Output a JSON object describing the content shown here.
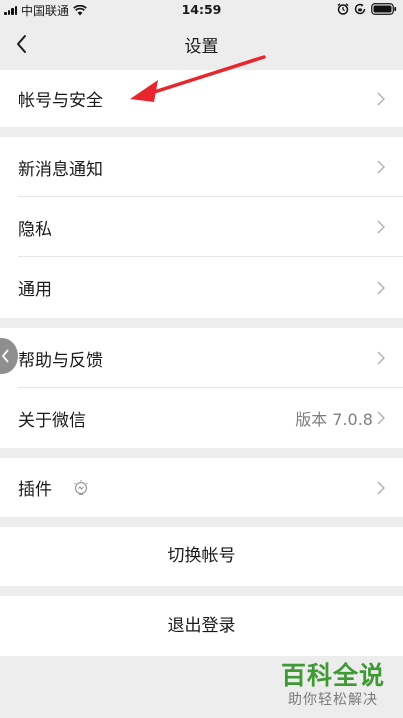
{
  "status_bar": {
    "carrier": "中国联通",
    "time": "14:59",
    "signal_icon": "signal-bars-icon",
    "wifi_icon": "wifi-icon",
    "alarm_icon": "alarm-icon",
    "lock_icon": "rotation-lock-icon",
    "battery_icon": "battery-icon"
  },
  "nav": {
    "title": "设置",
    "back_icon": "back-chevron-icon"
  },
  "sections": {
    "account_security": "帐号与安全",
    "new_message_notify": "新消息通知",
    "privacy": "隐私",
    "general": "通用",
    "help_feedback": "帮助与反馈",
    "about_wechat": "关于微信",
    "about_version": "版本 7.0.8",
    "plugins": "插件",
    "switch_account": "切换帐号",
    "logout": "退出登录"
  },
  "annotation": {
    "arrow_color": "#e8262e",
    "arrow_icon": "red-arrow-annotation"
  },
  "watermark": {
    "title": "百科全说",
    "subtitle": "助你轻松解决",
    "color": "#3f9a36"
  }
}
